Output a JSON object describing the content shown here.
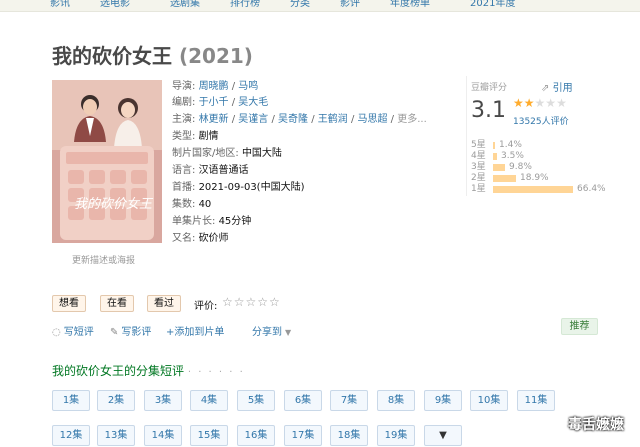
{
  "nav": {
    "items": [
      "影讯",
      "选电影",
      "选剧集",
      "排行榜",
      "分类",
      "影评",
      "年度榜单",
      "2021年度"
    ]
  },
  "title": {
    "name": "我的砍价女王",
    "year": "(2021)"
  },
  "poster": {
    "hint": "更新描述或海报",
    "art_text": "我的砍价女王",
    "colors": {
      "bg": "#d9a79f",
      "frame": "#f1d0c6",
      "keys": "#e9b6ab"
    }
  },
  "info": {
    "director_label": "导演:",
    "directors": [
      "周晓鹏",
      "马鸣"
    ],
    "writer_label": "编剧:",
    "writers": [
      "于小千",
      "吴大毛"
    ],
    "cast_label": "主演:",
    "cast": [
      "林更新",
      "吴谨言",
      "吴奇隆",
      "王鹤润",
      "马思超"
    ],
    "cast_more": "更多...",
    "genre_label": "类型:",
    "genre": "剧情",
    "country_label": "制片国家/地区:",
    "country": "中国大陆",
    "language_label": "语言:",
    "language": "汉语普通话",
    "premiere_label": "首播:",
    "premiere": "2021-09-03(中国大陆)",
    "episodes_label": "集数:",
    "episodes": "40",
    "runtime_label": "单集片长:",
    "runtime": "45分钟",
    "aka_label": "又名:",
    "aka": "砍价师"
  },
  "rating": {
    "label": "豆瓣评分",
    "ref_label": "引用",
    "score": "3.1",
    "stars_value": 1.5,
    "count": "13525人评价",
    "distribution": [
      {
        "label": "5星",
        "pct": "1.4%",
        "value": 1.4
      },
      {
        "label": "4星",
        "pct": "3.5%",
        "value": 3.5
      },
      {
        "label": "3星",
        "pct": "9.8%",
        "value": 9.8
      },
      {
        "label": "2星",
        "pct": "18.9%",
        "value": 18.9
      },
      {
        "label": "1星",
        "pct": "66.4%",
        "value": 66.4
      }
    ],
    "bar_color": "#ffd596"
  },
  "actions": {
    "want": "想看",
    "watching": "在看",
    "watched": "看过",
    "evaluate_label": "评价:",
    "empty_stars": "☆☆☆☆☆"
  },
  "links": {
    "short_review": "写短评",
    "review": "写影评",
    "add_list": "+添加到片单",
    "share": "分享到",
    "recommend": "推荐"
  },
  "episodes_section": {
    "title": "我的砍价女王的分集短评",
    "dots": "· · · · · ·",
    "episodes": [
      "1集",
      "2集",
      "3集",
      "4集",
      "5集",
      "6集",
      "7集",
      "8集",
      "9集",
      "10集",
      "11集",
      "12集",
      "13集",
      "14集",
      "15集",
      "16集",
      "17集",
      "18集",
      "19集"
    ],
    "more_icon": "▼"
  },
  "watermark": "毒舌嬷嬷"
}
